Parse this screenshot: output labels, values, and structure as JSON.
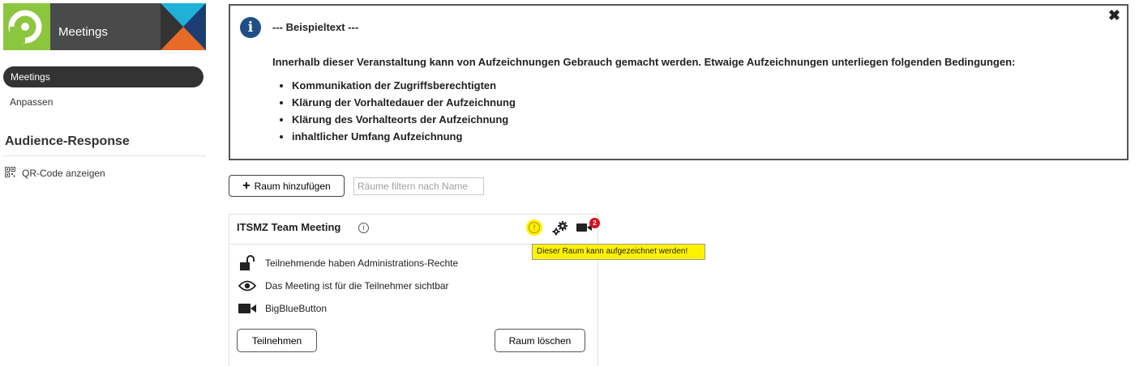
{
  "brand": {
    "title": "Meetings"
  },
  "sidebar": {
    "items": [
      {
        "label": "Meetings",
        "active": true
      },
      {
        "label": "Anpassen",
        "active": false
      }
    ],
    "section_title": "Audience-Response",
    "qr_link": {
      "label": "QR-Code anzeigen",
      "icon": "qr-code-icon"
    }
  },
  "info": {
    "icon": "info-icon",
    "heading": "--- Beispieltext ---",
    "intro": "Innerhalb dieser Veranstaltung kann von Aufzeichnungen Gebrauch gemacht werden. Etwaige Aufzeichnungen unterliegen folgenden Bedingungen:",
    "bullets": [
      "Kommunikation der Zugriffsberechtigten",
      "Klärung der Vorhaltedauer der Aufzeichnung",
      "Klärung des Vorhalteorts der Aufzeichnung",
      "inhaltlicher Umfang Aufzeichnung"
    ],
    "close_symbol": "✖"
  },
  "toolbar": {
    "add_room_label": "Raum hinzufügen",
    "filter_placeholder": "Räume filtern nach Name"
  },
  "room": {
    "title": "ITSMZ Team Meeting",
    "recording_badge": "2",
    "properties": [
      {
        "icon": "unlock-icon",
        "label": "Teilnehmende haben Administrations-Rechte"
      },
      {
        "icon": "eye-icon",
        "label": "Das Meeting ist für die Teilnehmer sichtbar"
      },
      {
        "icon": "video-camera-icon",
        "label": "BigBlueButton"
      }
    ],
    "join_label": "Teilnehmen",
    "delete_label": "Raum löschen",
    "tooltip": "Dieser Raum kann aufgezeichnet werden!"
  },
  "colors": {
    "brand_green": "#8cc63f",
    "brand_dark": "#4a4a4a",
    "info_blue": "#1f4f86",
    "highlight_yellow": "#fff200",
    "badge_red": "#d9131e"
  }
}
